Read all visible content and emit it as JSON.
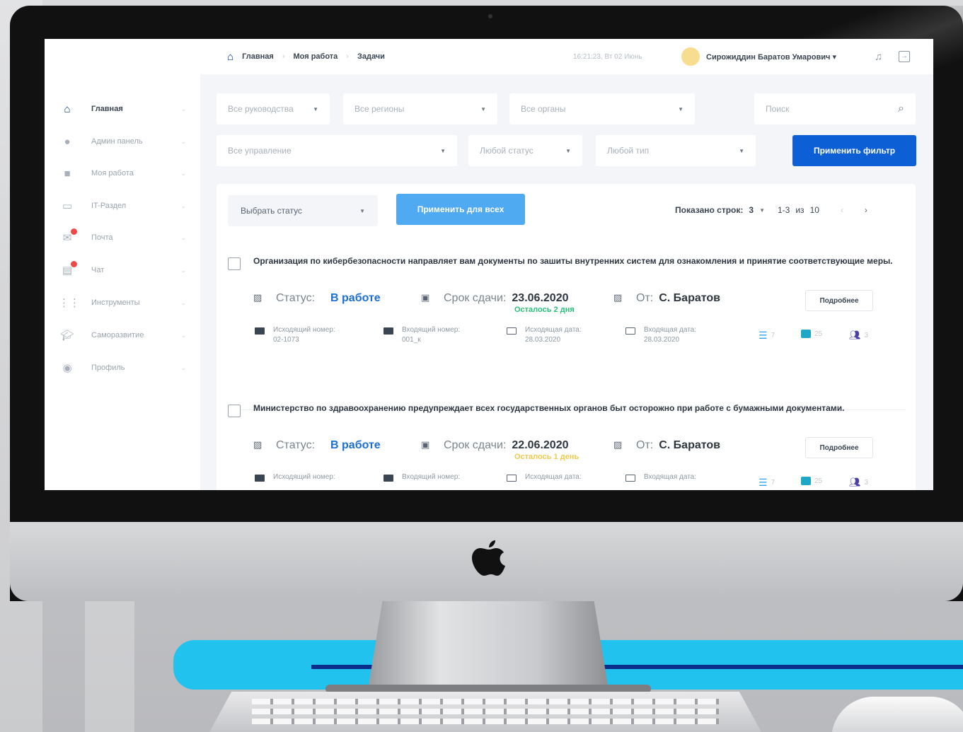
{
  "sidebar": {
    "items": [
      {
        "label": "Главная",
        "icon": "home-icon"
      },
      {
        "label": "Админ панель",
        "icon": "admin-icon"
      },
      {
        "label": "Моя работа",
        "icon": "briefcase-icon"
      },
      {
        "label": "IT-Раздел",
        "icon": "monitor-icon"
      },
      {
        "label": "Почта",
        "icon": "mail-icon"
      },
      {
        "label": "Чат",
        "icon": "chat-icon"
      },
      {
        "label": "Инструменты",
        "icon": "grid-icon"
      },
      {
        "label": "Саморазвитие",
        "icon": "graduation-cap-icon"
      },
      {
        "label": "Профиль",
        "icon": "profile-icon"
      }
    ]
  },
  "header": {
    "breadcrumb": [
      "Главная",
      "Моя работа",
      "Задачи"
    ],
    "datetime": "16:21:23, Вт 02 Июнь",
    "user": "Сирожиддин Баратов Умарович"
  },
  "filters": {
    "leadership": "Все руководства",
    "regions": "Все регионы",
    "organs": "Все органы",
    "search_placeholder": "Поиск",
    "management": "Все управление",
    "status": "Любой статус",
    "type": "Любой тип",
    "apply_filter": "Применить фильтр"
  },
  "toolbar": {
    "select_status": "Выбрать статус",
    "apply_all": "Применить для всех",
    "rows_label": "Показано строк:",
    "rows_value": "3",
    "range": "1-3",
    "of": "из",
    "total": "10"
  },
  "tasks": [
    {
      "title": "Организация по кибербезопасности направляет вам документы по зашиты внутренних систем для ознакомления и принятие соответствующие меры.",
      "status_label": "Статус:",
      "status": "В работе",
      "deadline_label": "Срок сдачи:",
      "deadline": "23.06.2020",
      "remaining": "Осталось 2 дня",
      "from_label": "От:",
      "from": "С. Баратов",
      "details": "Подробнее",
      "out_num_label": "Исходящий номер:",
      "out_num": "02-1073",
      "in_num_label": "Входящий номер:",
      "in_num": "001_к",
      "out_date_label": "Исходящая дата:",
      "out_date": "28.03.2020",
      "in_date_label": "Входящая дата:",
      "in_date": "28.03.2020",
      "count_list": "7",
      "count_chat": "25",
      "count_users": "3"
    },
    {
      "title": "Министерство по здравоохранению предупреждает всех государственных органов быт осторожно при работе с бумажными документами.",
      "status_label": "Статус:",
      "status": "В работе",
      "deadline_label": "Срок сдачи:",
      "deadline": "22.06.2020",
      "remaining": "Осталось 1 день",
      "from_label": "От:",
      "from": "С. Баратов",
      "details": "Подробнее",
      "out_num_label": "Исходящий номер:",
      "in_num_label": "Входящий номер:",
      "out_date_label": "Исходящая дата:",
      "in_date_label": "Входящая дата:",
      "count_list": "7",
      "count_chat": "25",
      "count_users": "3"
    }
  ],
  "colors": {
    "primary": "#0d5fd6",
    "light_blue": "#4faaf2",
    "green": "#2bc07a",
    "yellow": "#f2c94c",
    "teal_band": "#21c3ee",
    "navy": "#0b2e8c"
  }
}
